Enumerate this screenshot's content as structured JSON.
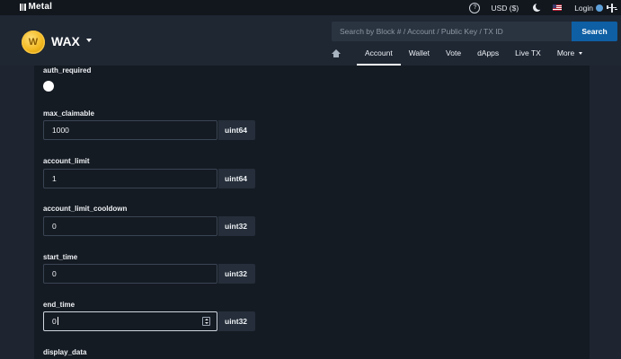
{
  "topbar": {
    "brand": "Metal",
    "currency": "USD ($)",
    "login": "Login"
  },
  "header": {
    "network": "WAX",
    "search": {
      "placeholder": "Search by Block # / Account / Public Key / TX ID",
      "button_label": "Search"
    },
    "nav": [
      "Account",
      "Wallet",
      "Vote",
      "dApps",
      "Live TX",
      "More"
    ],
    "active_nav": "Account"
  },
  "form": {
    "fields": [
      {
        "label": "auth_required",
        "kind": "toggle"
      },
      {
        "label": "max_claimable",
        "value": "1000",
        "type": "uint64"
      },
      {
        "label": "account_limit",
        "value": "1",
        "type": "uint64"
      },
      {
        "label": "account_limit_cooldown",
        "value": "0",
        "type": "uint32"
      },
      {
        "label": "start_time",
        "value": "0",
        "type": "uint32"
      },
      {
        "label": "end_time",
        "value": "0",
        "type": "uint32",
        "focused": true
      },
      {
        "label": "display_data"
      }
    ]
  },
  "colors": {
    "accent": "#0e5fa4",
    "background": "#1e2530",
    "panel": "#151b23",
    "wax_gold": "#f2b81f"
  }
}
